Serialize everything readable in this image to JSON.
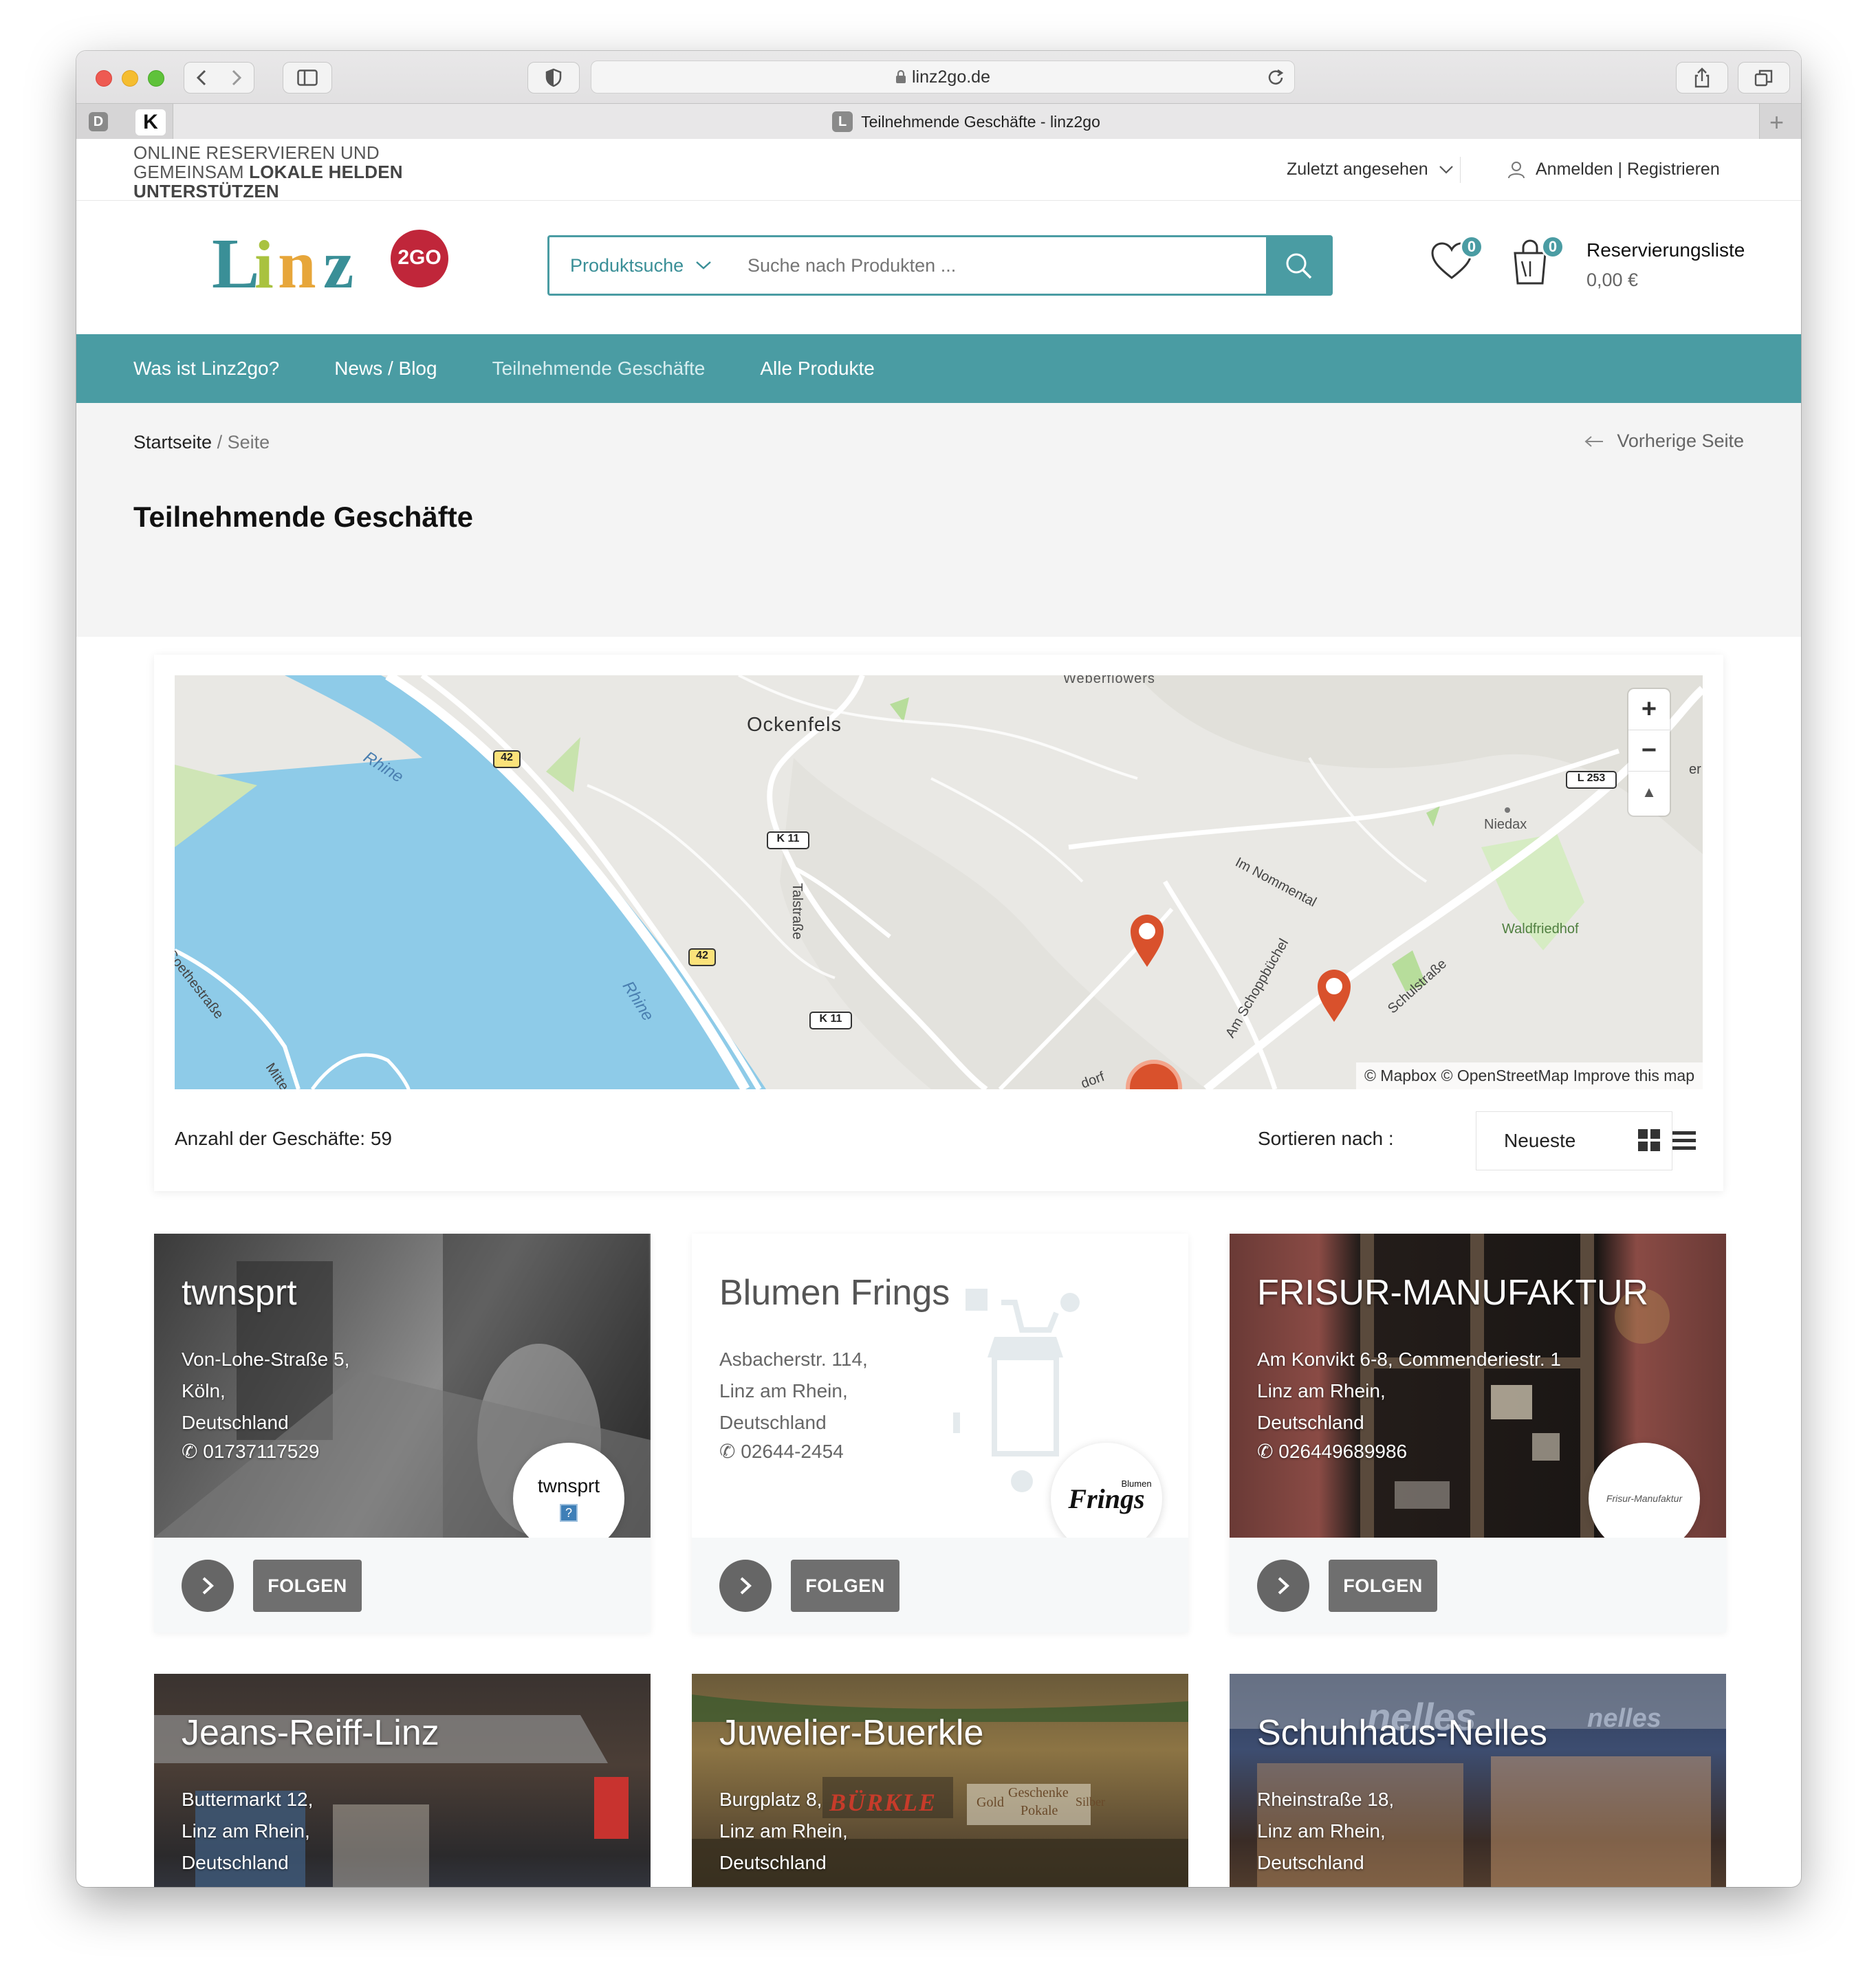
{
  "browser": {
    "url": "linz2go.de",
    "tab_title": "Teilnehmende Geschäfte - linz2go",
    "tab_favicon_letter": "L",
    "pinned_tabs": [
      "D",
      "K"
    ]
  },
  "topbar": {
    "tagline_line1": "ONLINE RESERVIEREN UND",
    "tagline_line2_plain": "GEMEINSAM ",
    "tagline_line2_bold": "LOKALE HELDEN",
    "tagline_line3": "UNTERSTÜTZEN",
    "recently_viewed": "Zuletzt angesehen",
    "login": "Anmelden | Registrieren"
  },
  "header": {
    "logo_text": "Linz",
    "logo_badge": "2GO",
    "search_category": "Produktsuche",
    "search_placeholder": "Suche nach Produkten ...",
    "wishlist_count": "0",
    "cart_count": "0",
    "cart_label": "Reservierungsliste",
    "cart_total": "0,00 €"
  },
  "nav": {
    "items": [
      "Was ist Linz2go?",
      "News / Blog",
      "Teilnehmende Geschäfte",
      "Alle Produkte"
    ]
  },
  "breadcrumb": {
    "home": "Startseite",
    "separator": " / ",
    "current": "Seite",
    "prev_page": "Vorherige Seite"
  },
  "page_title": "Teilnehmende Geschäfte",
  "map": {
    "labels": [
      "Weberflowers",
      "Ockenfels",
      "Rhine",
      "Rhine",
      "Niedax",
      "Waldfriedhof",
      "Talstraße",
      "Im Nommental",
      "Am Schoppbüchel",
      "Schulstraße",
      "Goethestraße",
      "Mitte",
      "dorf",
      "er"
    ],
    "road_badges": [
      "42",
      "42",
      "K 11",
      "K 11",
      "L 253"
    ],
    "attribution": "© Mapbox © OpenStreetMap Improve this map",
    "zoom_in": "+",
    "zoom_out": "−",
    "compass": "▲"
  },
  "listing": {
    "count_label": "Anzahl der Geschäfte: 59",
    "sort_label": "Sortieren nach :",
    "sort_value": "Neueste"
  },
  "stores": [
    {
      "name": "twnsprt",
      "addr1": "Von-Lohe-Straße 5,",
      "addr2": "Köln,",
      "addr3": "Deutschland",
      "phone": "01737117529",
      "logo_text": "twnsprt",
      "follow": "FOLGEN"
    },
    {
      "name": "Blumen Frings",
      "addr1": "Asbacherstr. 114,",
      "addr2": "Linz am Rhein,",
      "addr3": "Deutschland",
      "phone": "02644-2454",
      "logo_text": "Frings",
      "logo_small": "Blumen",
      "follow": "FOLGEN"
    },
    {
      "name": "FRISUR-MANUFAKTUR",
      "addr1": "Am Konvikt 6-8, Commenderiestr. 1",
      "addr2": "Linz am Rhein,",
      "addr3": "Deutschland",
      "phone": "026449689986",
      "logo_text": "Frisur-Manufaktur",
      "follow": "FOLGEN"
    },
    {
      "name": "Jeans-Reiff-Linz",
      "addr1": "Buttermarkt 12,",
      "addr2": "Linz am Rhein,",
      "addr3": "Deutschland"
    },
    {
      "name": "Juwelier-Buerkle",
      "addr1": "Burgplatz 8,",
      "addr2": "Linz am Rhein,",
      "addr3": "Deutschland",
      "sign1": "BÜRKLE",
      "sign2": "Geschenke",
      "sign3": "Pokale",
      "sign4": "Gold",
      "sign5": "Silber"
    },
    {
      "name": "Schuhhaus-Nelles",
      "addr1": "Rheinstraße 18,",
      "addr2": "Linz am Rhein,",
      "addr3": "Deutschland",
      "sign1": "nelles",
      "sign2": "nelles"
    }
  ]
}
